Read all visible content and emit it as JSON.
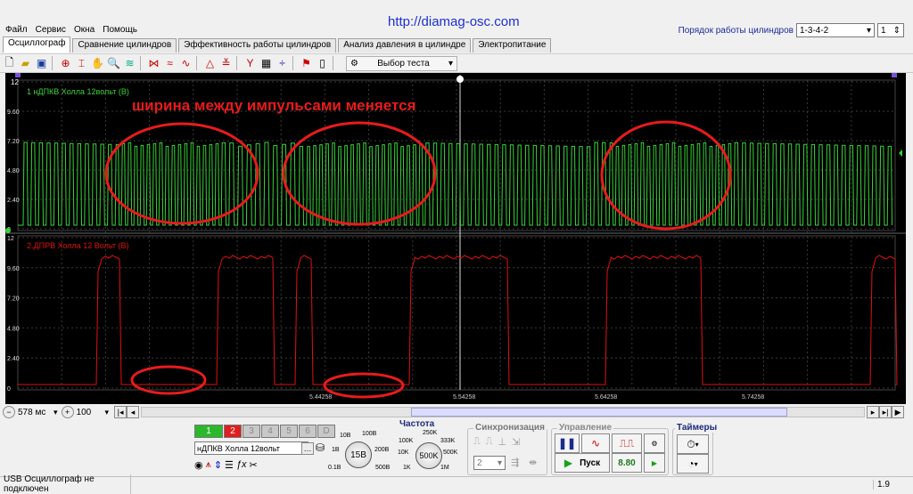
{
  "menu": [
    "Файл",
    "Сервис",
    "Окна",
    "Помощь"
  ],
  "site_url": "http://diamag-osc.com",
  "cylinder_order": {
    "label": "Порядок работы цилиндров",
    "value": "1-3-4-2",
    "count": "1"
  },
  "tabs": [
    "Осциллограф",
    "Сравнение цилиндров",
    "Эффективность работы цилиндров",
    "Анализ давления в цилиндре",
    "Электропитание"
  ],
  "toolbar": {
    "test_select": "Выбор теста"
  },
  "scope": {
    "annotation": "ширина между импульсами меняется",
    "ch1_label": "1 нДПКВ Холла 12вольт (В)",
    "ch2_label": "2.ДПРВ Холла 12 Вольт (В)",
    "y_ticks": [
      "12",
      "9.60",
      "7.20",
      "4.80",
      "2.40",
      "0"
    ],
    "x_ticks": [
      "5.34258",
      "5.44258",
      "5.54258",
      "5.64258",
      "5.74258"
    ],
    "colors": {
      "ch1": "#39d339",
      "ch2": "#e01010",
      "annotation": "#e81b1b"
    }
  },
  "scroll": {
    "time": "578 мс",
    "zoom": "100"
  },
  "panel": {
    "channels": [
      "1",
      "2",
      "3",
      "4",
      "5",
      "6",
      "D"
    ],
    "channel_name": "нДПКВ Холла 12вольт",
    "volt_scale": {
      "labels": [
        "10В",
        "100В",
        "1В",
        "200В",
        "0.1В",
        "500В"
      ],
      "value": "15В"
    },
    "freq_title": "Частота",
    "freq_scale": {
      "labels": [
        "250K",
        "100K",
        "333K",
        "10K",
        "500K",
        "1K",
        "1M"
      ],
      "value": "500K"
    },
    "sync_title": "Синхронизация",
    "sync_value": "2",
    "control_title": "Управление",
    "start_label": "Пуск",
    "speed_value": "8.80",
    "timers_title": "Таймеры"
  },
  "status": {
    "left": "USB Осциллограф не подключен",
    "right": "1.9"
  }
}
